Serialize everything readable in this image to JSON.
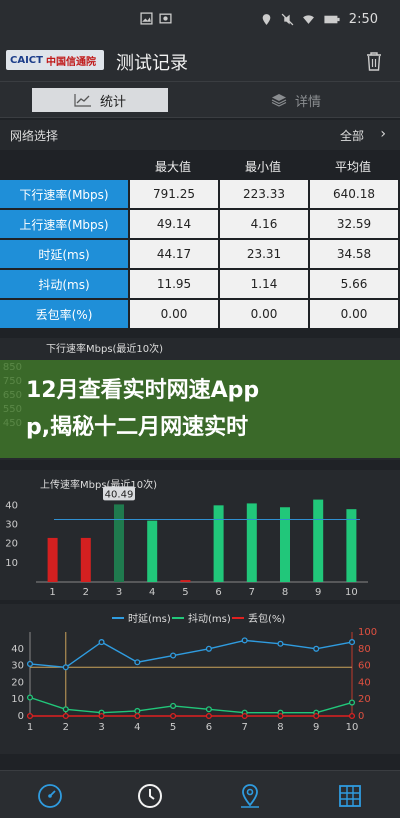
{
  "status_bar": {
    "time": "2:50"
  },
  "app_bar": {
    "logo_text_blue": "CAICT",
    "logo_text_red": "中国信通院",
    "title": "测试记录"
  },
  "tabs": [
    {
      "label": "统计",
      "selected": true
    },
    {
      "label": "详情",
      "selected": false
    }
  ],
  "network_select": {
    "label": "网络选择",
    "value": "全部"
  },
  "stats_table": {
    "headers": [
      "最大值",
      "最小值",
      "平均值"
    ],
    "rows": [
      {
        "label": "下行速率(Mbps)",
        "values": [
          "791.25",
          "223.33",
          "640.18"
        ]
      },
      {
        "label": "上行速率(Mbps)",
        "values": [
          "49.14",
          "4.16",
          "32.59"
        ]
      },
      {
        "label": "时延(ms)",
        "values": [
          "44.17",
          "23.31",
          "34.58"
        ]
      },
      {
        "label": "抖动(ms)",
        "values": [
          "11.95",
          "1.14",
          "5.66"
        ]
      },
      {
        "label": "丢包率(%)",
        "values": [
          "0.00",
          "0.00",
          "0.00"
        ]
      }
    ]
  },
  "overlay_banner": {
    "line1": "12月查看实时网速App",
    "line2": "p,揭秘十二月网速实时"
  },
  "chart_data": [
    {
      "type": "bar",
      "title": "下行速率Mbps(最近10次)",
      "y_ticks": [
        "850",
        "750",
        "650",
        "550",
        "450"
      ],
      "visible_portion": "partial"
    },
    {
      "type": "bar",
      "title": "上传速率Mbps(最近10次)",
      "categories": [
        "1",
        "2",
        "3",
        "4",
        "5",
        "6",
        "7",
        "8",
        "9",
        "10"
      ],
      "values": [
        23,
        23,
        40.49,
        32,
        1,
        40,
        41,
        39,
        43,
        38
      ],
      "colors": [
        "#d42020",
        "#d42020",
        "#1f7a4e",
        "#21c77a",
        "#d42020",
        "#21c77a",
        "#21c77a",
        "#21c77a",
        "#21c77a",
        "#21c77a"
      ],
      "highlight_label": "40.49",
      "average_line": 32.59,
      "y_ticks": [
        "40",
        "30",
        "20",
        "10"
      ],
      "ylim": [
        0,
        48
      ]
    },
    {
      "type": "line",
      "legend": [
        "时延(ms)",
        "抖动(ms)",
        "丢包(%)"
      ],
      "colors": [
        "#2f9ce0",
        "#21c77a",
        "#e02020"
      ],
      "x": [
        "1",
        "2",
        "3",
        "4",
        "5",
        "6",
        "7",
        "8",
        "9",
        "10"
      ],
      "series": [
        {
          "name": "时延(ms)",
          "axis": "left",
          "values": [
            31,
            29,
            44,
            32,
            36,
            40,
            45,
            43,
            40,
            44
          ]
        },
        {
          "name": "抖动(ms)",
          "axis": "left",
          "values": [
            11,
            4,
            2,
            3,
            6,
            4,
            2,
            2,
            2,
            8
          ]
        },
        {
          "name": "丢包(%)",
          "axis": "right",
          "values": [
            0,
            0,
            0,
            0,
            0,
            0,
            0,
            0,
            0,
            0
          ]
        }
      ],
      "left_ticks": [
        "40",
        "30",
        "20",
        "10",
        "0"
      ],
      "right_ticks": [
        "100",
        "80",
        "60",
        "40",
        "20",
        "0"
      ],
      "left_ylim": [
        0,
        50
      ],
      "right_ylim": [
        0,
        100
      ]
    }
  ],
  "bottom_nav": [
    "speed-test",
    "history",
    "map",
    "statistics"
  ]
}
